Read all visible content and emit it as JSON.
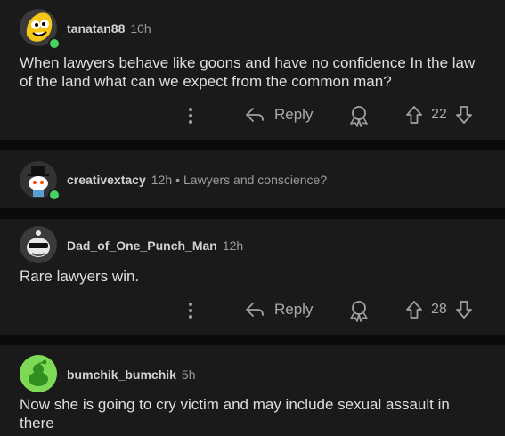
{
  "comments": [
    {
      "username": "tanatan88",
      "time": "10h",
      "body": "When lawyers behave like goons and have no confidence In the law of the land what can we expect from the common man?",
      "reply_label": "Reply",
      "score": "22",
      "avatar_icon": "banana-avatar-icon",
      "online": true
    },
    {
      "username": "creativextacy",
      "time": "12h",
      "separator": "•",
      "snippet": "Lawyers and conscience?",
      "avatar_icon": "snoo-tophat-avatar-icon",
      "online": true
    },
    {
      "username": "Dad_of_One_Punch_Man",
      "time": "12h",
      "body": "Rare lawyers win.",
      "reply_label": "Reply",
      "score": "28",
      "avatar_icon": "snoo-sunglasses-avatar-icon",
      "online": false
    },
    {
      "username": "bumchik_bumchik",
      "time": "5h",
      "body": "Now she is going to cry victim and may include sexual assault in there",
      "avatar_icon": "green-snoo-avatar-icon",
      "online": false
    }
  ],
  "colors": {
    "background": "#0b0b0b",
    "card": "#1a1a1b",
    "online_dot": "#46d160"
  }
}
